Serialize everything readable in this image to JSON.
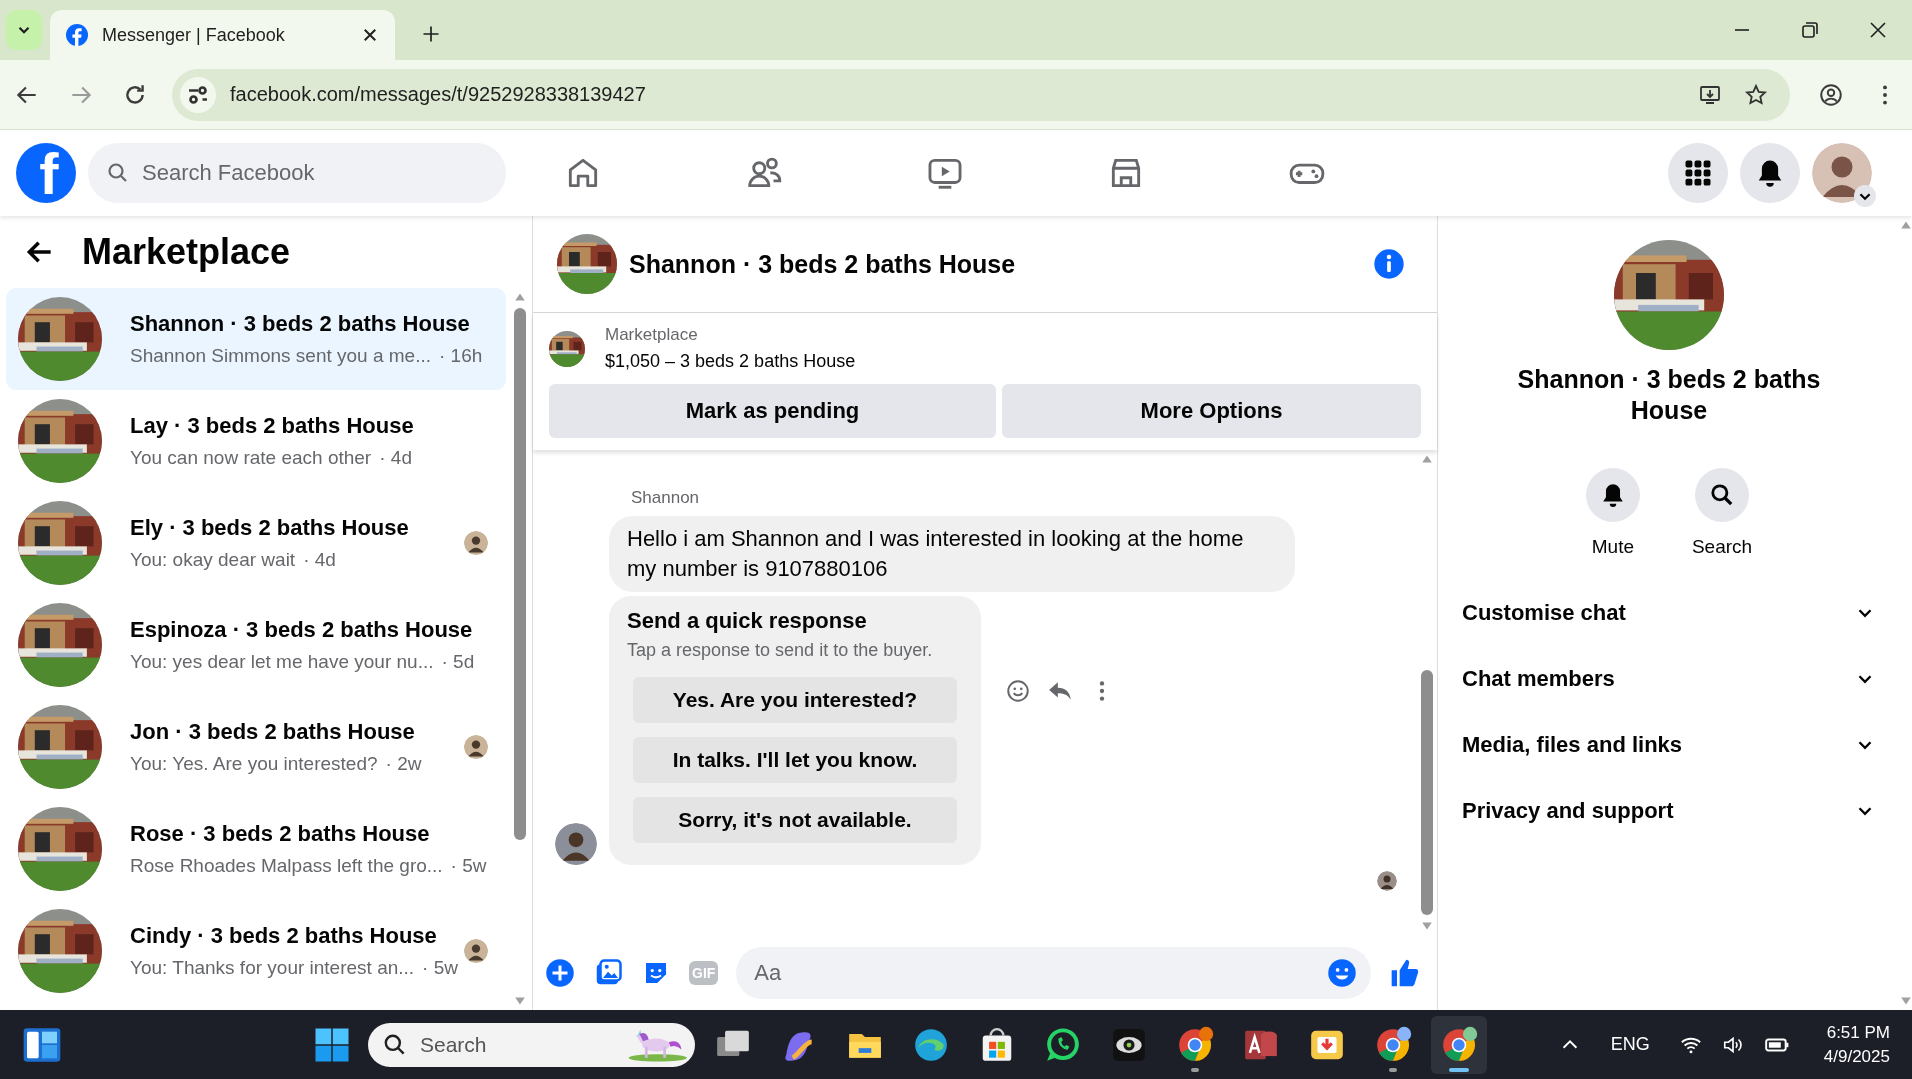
{
  "browser": {
    "tab_title": "Messenger | Facebook",
    "url": "facebook.com/messages/t/9252928338139427"
  },
  "header": {
    "logo_letter": "f",
    "search_placeholder": "Search Facebook"
  },
  "sidebar": {
    "title": "Marketplace",
    "conversations": [
      {
        "name": "Shannon · 3 beds 2 baths House",
        "preview": "Shannon Simmons sent you a me...",
        "time": "· 16h",
        "selected": true,
        "seen": false
      },
      {
        "name": "Lay · 3 beds 2 baths House",
        "preview": "You can now rate each other",
        "time": "· 4d",
        "selected": false,
        "seen": false
      },
      {
        "name": "Ely · 3 beds 2 baths House",
        "preview": "You: okay dear wait",
        "time": "· 4d",
        "selected": false,
        "seen": true
      },
      {
        "name": "Espinoza · 3 beds 2 baths House",
        "preview": "You: yes dear let me have your nu...",
        "time": "· 5d",
        "selected": false,
        "seen": false
      },
      {
        "name": "Jon · 3 beds 2 baths House",
        "preview": "You: Yes. Are you interested?",
        "time": "· 2w",
        "selected": false,
        "seen": true
      },
      {
        "name": "Rose · 3 beds 2 baths House",
        "preview": "Rose Rhoades Malpass left the gro...",
        "time": "· 5w",
        "selected": false,
        "seen": false
      },
      {
        "name": "Cindy · 3 beds 2 baths House",
        "preview": "You: Thanks for your interest an...",
        "time": "· 5w",
        "selected": false,
        "seen": true
      }
    ]
  },
  "chat": {
    "title": "Shannon · 3 beds 2 baths House",
    "listing": {
      "label": "Marketplace",
      "summary": "$1,050 – 3 beds 2 baths House"
    },
    "actions": [
      "Mark as pending",
      "More Options"
    ],
    "sender": "Shannon",
    "message": "Hello i am Shannon and I was interested in looking at the home my number is 9107880106",
    "quick_response": {
      "title": "Send a quick response",
      "subtitle": "Tap a response to send it to the buyer.",
      "options": [
        "Yes. Are you interested?",
        "In talks. I'll let you know.",
        "Sorry, it's not available."
      ]
    },
    "composer": {
      "gif_label": "GIF",
      "placeholder": "Aa"
    }
  },
  "details": {
    "title": "Shannon · 3 beds 2 baths House",
    "actions": [
      {
        "kind": "mute",
        "label": "Mute"
      },
      {
        "kind": "search",
        "label": "Search"
      }
    ],
    "sections": [
      {
        "label": "Customise chat",
        "expanded": false
      },
      {
        "label": "Chat members",
        "expanded": false
      },
      {
        "label": "Media, files and links",
        "expanded": false
      },
      {
        "label": "Privacy and support",
        "expanded": false
      }
    ]
  },
  "taskbar": {
    "search_placeholder": "Search",
    "apps": [
      {
        "kind": "task-view",
        "running": false,
        "selected": false
      },
      {
        "kind": "copilot",
        "running": false,
        "selected": false
      },
      {
        "kind": "folder",
        "running": false,
        "selected": false
      },
      {
        "kind": "edge",
        "running": false,
        "selected": false
      },
      {
        "kind": "store",
        "running": false,
        "selected": false
      },
      {
        "kind": "whatsapp",
        "running": false,
        "selected": false
      },
      {
        "kind": "camera",
        "running": false,
        "selected": false
      },
      {
        "kind": "chrome",
        "color": "#e8710a",
        "running": true,
        "selected": false
      },
      {
        "kind": "access",
        "running": false,
        "selected": false
      },
      {
        "kind": "download",
        "running": false,
        "selected": false
      },
      {
        "kind": "chrome",
        "color": "#8ab4f8",
        "running": true,
        "selected": false
      },
      {
        "kind": "chrome",
        "color": "#81c995",
        "running": true,
        "selected": true
      }
    ],
    "language": "ENG",
    "time": "6:51 PM",
    "date": "4/9/2025"
  }
}
